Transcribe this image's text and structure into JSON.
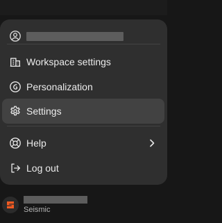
{
  "menu": {
    "items": [
      {
        "label": "Workspace settings",
        "icon": "building-icon"
      },
      {
        "label": "Personalization",
        "icon": "personalization-icon"
      },
      {
        "label": "Settings",
        "icon": "gear-icon",
        "active": true
      },
      {
        "label": "Help",
        "icon": "lifebuoy-icon"
      },
      {
        "label": "Log out",
        "icon": "logout-icon"
      }
    ]
  },
  "user": {
    "org": "Seismic"
  },
  "colors": {
    "background": "#171717",
    "menu_bg": "#2f2f2f",
    "active_item_bg": "#424242",
    "text": "#ececec",
    "muted_text": "#b4b4b4",
    "brand_logo": "#f05a22"
  }
}
